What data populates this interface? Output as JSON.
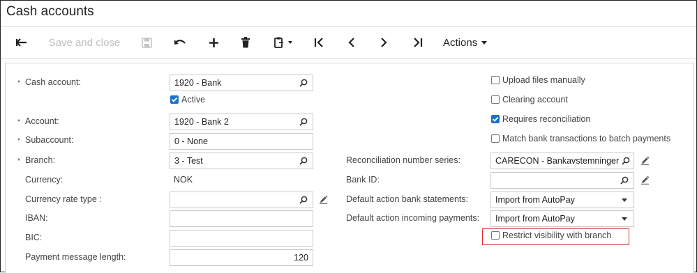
{
  "window": {
    "title": "Cash accounts"
  },
  "toolbar": {
    "save_and_close": "Save and close",
    "actions": "Actions",
    "icons": [
      "back-arrow-icon",
      "save-icon",
      "undo-icon",
      "add-icon",
      "delete-icon",
      "copy-paste-icon",
      "first-icon",
      "prev-icon",
      "next-icon",
      "last-icon"
    ]
  },
  "form": {
    "cash_account": {
      "label": "Cash account:",
      "value": "1920 - Bank"
    },
    "active": {
      "label": "Active",
      "checked": true
    },
    "account": {
      "label": "Account:",
      "value": "1920 - Bank 2"
    },
    "subaccount": {
      "label": "Subaccount:",
      "value": "0 - None"
    },
    "branch": {
      "label": "Branch:",
      "value": "3 - Test"
    },
    "currency": {
      "label": "Currency:",
      "value": "NOK"
    },
    "currency_rate_type": {
      "label": "Currency rate type :",
      "value": ""
    },
    "iban": {
      "label": "IBAN:",
      "value": ""
    },
    "bic": {
      "label": "BIC:",
      "value": ""
    },
    "payment_message_length": {
      "label": "Payment message length:",
      "value": "120"
    },
    "reconciliation_number_series": {
      "label": "Reconciliation number series:",
      "value": "CARECON - Bankavstemninger"
    },
    "bank_id": {
      "label": "Bank ID:",
      "value": ""
    },
    "default_action_bank_statements": {
      "label": "Default action bank statements:",
      "value": "Import from AutoPay"
    },
    "default_action_incoming_payments": {
      "label": "Default action incoming payments:",
      "value": "Import from AutoPay"
    },
    "upload_files_manually": {
      "label": "Upload files manually",
      "checked": false
    },
    "clearing_account": {
      "label": "Clearing account",
      "checked": false
    },
    "requires_reconciliation": {
      "label": "Requires reconciliation",
      "checked": true
    },
    "match_bank_transactions": {
      "label": "Match bank transactions to batch payments",
      "checked": false
    },
    "restrict_visibility": {
      "label": "Restrict visibility with branch",
      "checked": false
    }
  },
  "colors": {
    "accent": "#1a73c9",
    "highlight": "#d93030",
    "disabled_text": "#bdbdbd"
  }
}
